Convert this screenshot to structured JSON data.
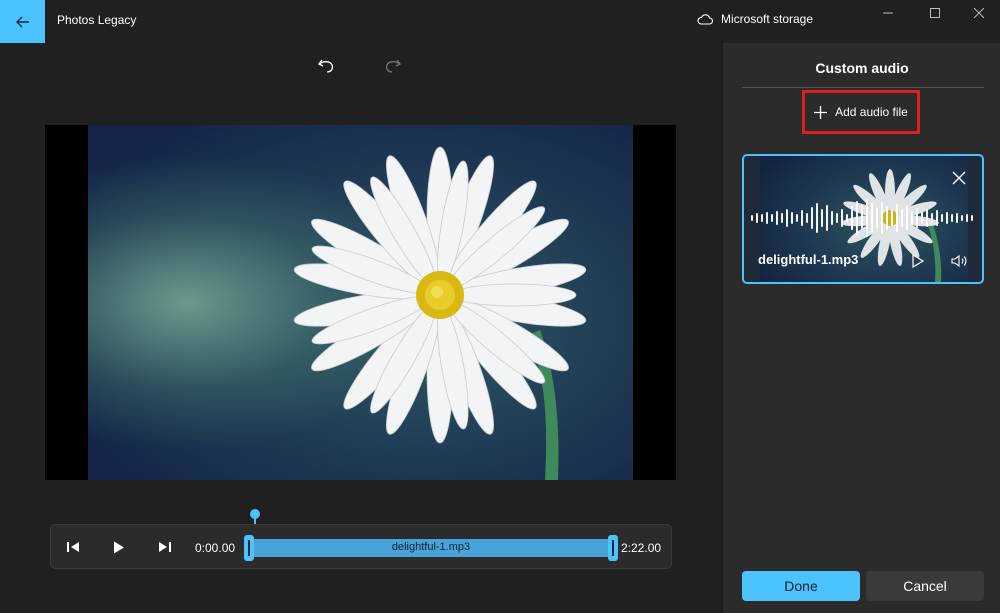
{
  "app": {
    "title": "Photos Legacy",
    "storage_label": "Microsoft storage"
  },
  "icons": {
    "back": "arrow-left-icon",
    "cloud": "cloud-icon",
    "minimize": "minimize-icon",
    "maximize": "maximize-icon",
    "close": "close-icon",
    "undo": "undo-icon",
    "redo": "redo-icon",
    "prev_frame": "step-back-icon",
    "play": "play-icon",
    "next_frame": "step-forward-icon",
    "add": "plus-icon",
    "remove": "x-icon",
    "preview": "play-outline-icon",
    "volume": "volume-icon"
  },
  "playback": {
    "start_time": "0:00.00",
    "end_time": "2:22.00",
    "track_label": "delightful-1.mp3"
  },
  "panel": {
    "title": "Custom audio",
    "add_audio_label": "Add audio file",
    "audio_items": [
      {
        "name": "delightful-1.mp3"
      }
    ],
    "done_label": "Done",
    "cancel_label": "Cancel"
  },
  "colors": {
    "accent": "#4cc2ff",
    "highlight_box": "#e11d1d",
    "background": "#202020",
    "panel": "#2b2b2b"
  }
}
